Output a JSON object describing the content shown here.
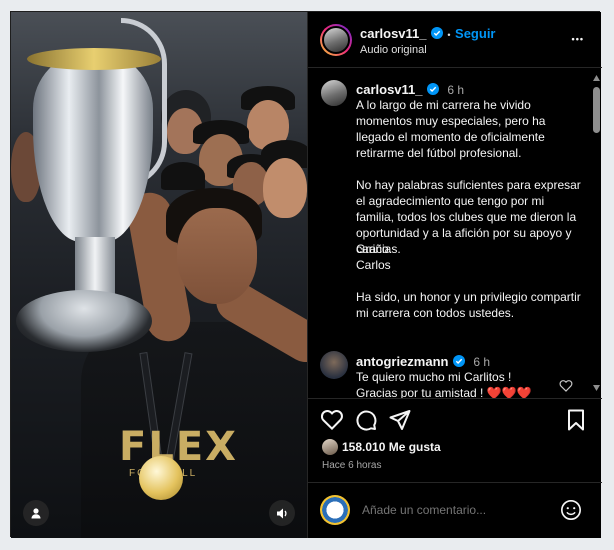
{
  "post": {
    "author": "carlosv11_",
    "follow_label": "Seguir",
    "separator": "•",
    "audio": "Audio original",
    "more_label": "•••"
  },
  "caption": {
    "author": "carlosv11_",
    "time": "6 h",
    "paragraphs": [
      "A lo largo de mi carrera he vivido momentos muy especiales, pero ha llegado el momento de oficialmente retirarme del fútbol profesional.",
      "No hay palabras suficientes para expresar el agradecimiento que tengo por mi familia, todos los clubes que me dieron la oportunidad y a la afición por su apoyo y cariño.",
      "Gracias.",
      "Carlos",
      "Ha sido, un honor y un privilegio compartir mi carrera con todos ustedes."
    ]
  },
  "comment": {
    "author": "antogriezmann",
    "time": "6 h",
    "line1": "Te quiero mucho mi Carlitos !",
    "line2": "Gracias por tu amistad ! ❤️❤️❤️"
  },
  "media": {
    "jersey_text": "FLEX",
    "jersey_sub": "FOOTBALL"
  },
  "stats": {
    "likes": "158.010 Me gusta",
    "ago": "Hace 6 horas"
  },
  "compose": {
    "placeholder": "Añade un comentario..."
  },
  "colors": {
    "accent": "#0095f6",
    "verified": "#0095f6",
    "heart": "#ff3040"
  }
}
